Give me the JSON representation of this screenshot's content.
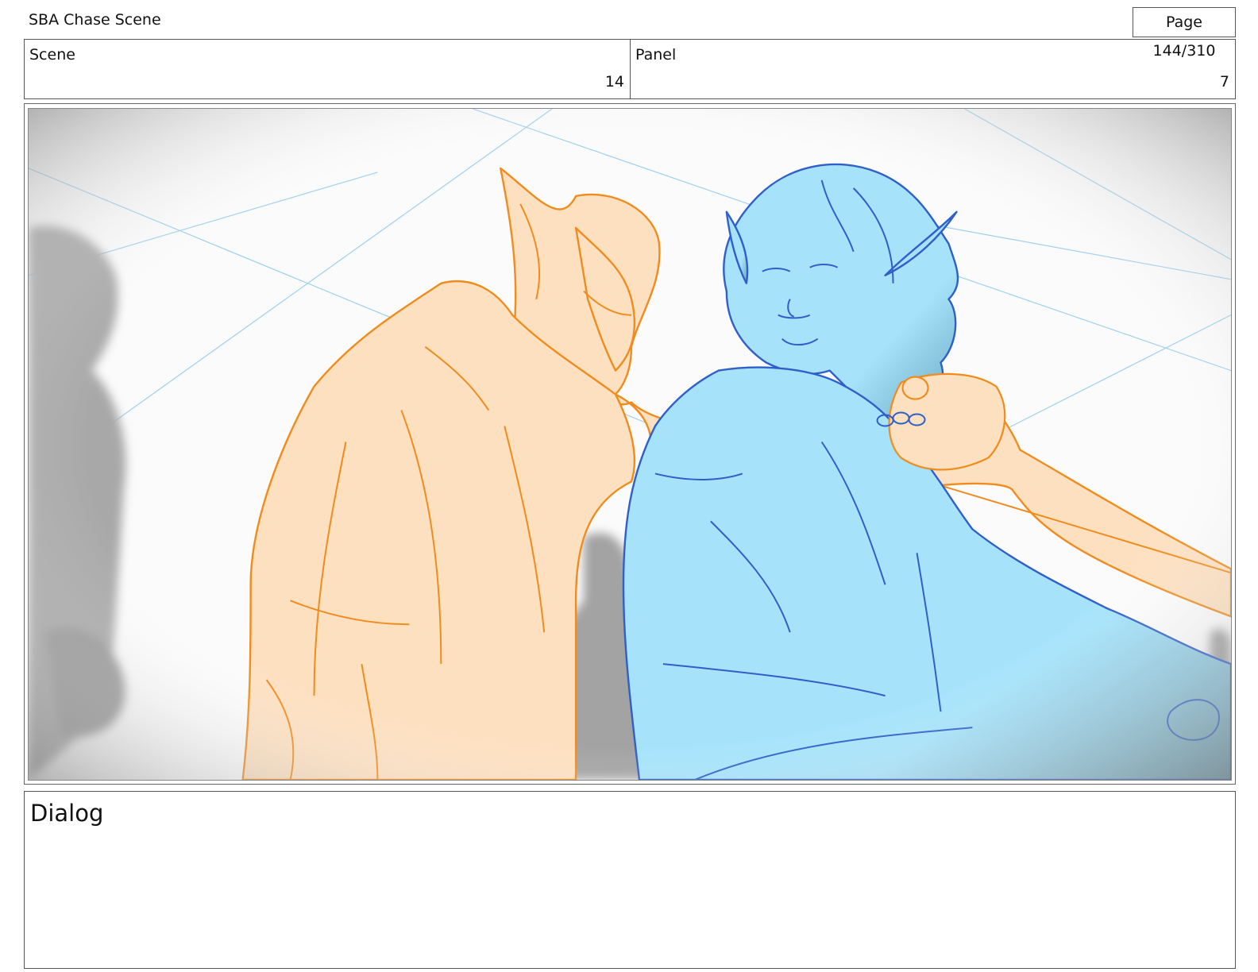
{
  "header": {
    "title": "SBA Chase Scene",
    "page": "Page 144/310"
  },
  "info": {
    "scene_label": "Scene",
    "scene_value": "14",
    "panel_label": "Panel",
    "panel_value": "7"
  },
  "frame": {
    "description_icon": "storyboard-sketch-image"
  },
  "dialog": {
    "label": "Dialog",
    "text": ""
  },
  "colors": {
    "orange_fill": "#fde0c0",
    "orange_line": "#f08c1e",
    "blue_fill": "#a6e3fb",
    "blue_line": "#2f5fc9",
    "gray_figure": "#a8a8a8",
    "guide_line": "#9fd0ef"
  }
}
